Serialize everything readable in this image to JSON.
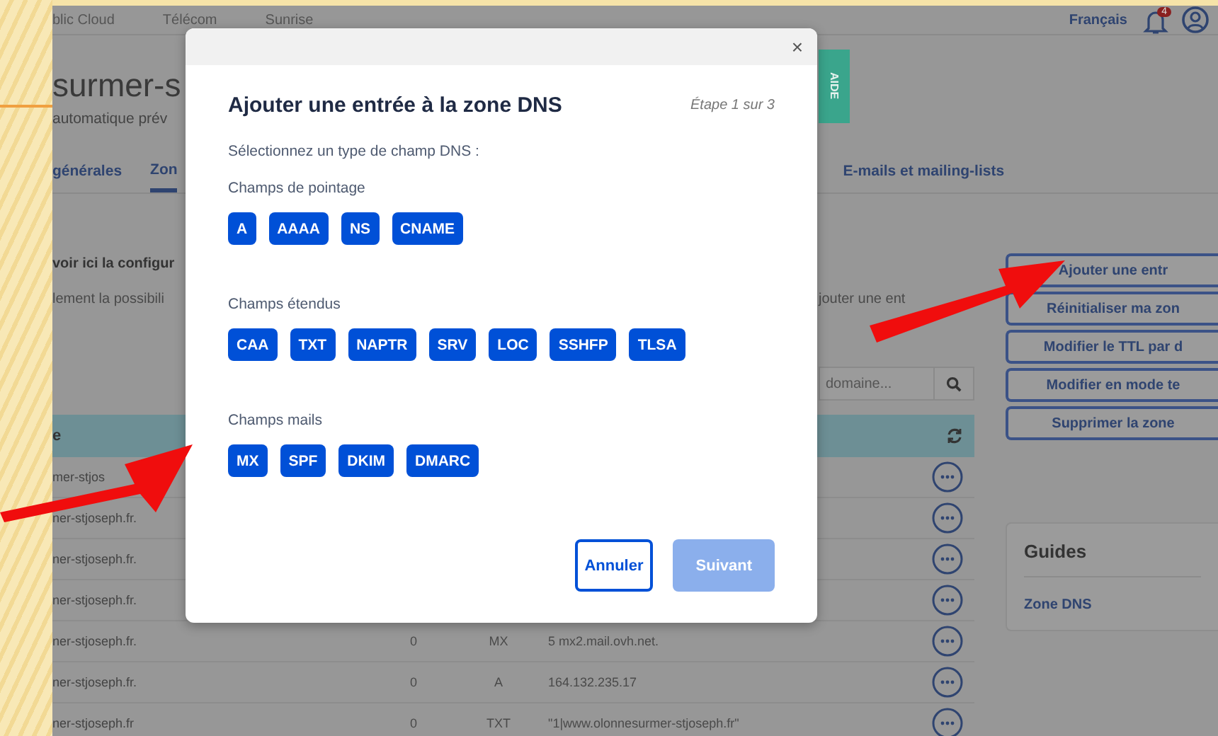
{
  "topnav": {
    "items": [
      "blic Cloud",
      "Télécom",
      "Sunrise"
    ],
    "language": "Français",
    "notification_count": "4"
  },
  "page": {
    "title": "surmer-s",
    "subtitle": "automatique prév",
    "tabs": [
      {
        "label": "générales",
        "selected": false
      },
      {
        "label": "Zon",
        "selected": true
      },
      {
        "label": "E-mails et mailing-lists",
        "selected": false
      }
    ],
    "help_tab": "AIDE",
    "intro_title": "voir ici la configur",
    "intro_text": "lement la possibili",
    "intro_text_right": "jouter une ent",
    "search": {
      "placeholder": "domaine..."
    },
    "table": {
      "column_1": "e",
      "rows": [
        {
          "name": "mer-stjos"
        },
        {
          "name": "ner-stjoseph.fr."
        },
        {
          "name": "ner-stjoseph.fr."
        },
        {
          "name": "ner-stjoseph.fr."
        },
        {
          "name": "ner-stjoseph.fr.",
          "ttl": "0",
          "type": "MX",
          "target": "5 mx2.mail.ovh.net."
        },
        {
          "name": "ner-stjoseph.fr.",
          "ttl": "0",
          "type": "A",
          "target": "164.132.235.17"
        },
        {
          "name": "ner-stjoseph.fr",
          "ttl": "0",
          "type": "TXT",
          "target": "\"1|www.olonnesurmer-stjoseph.fr\""
        }
      ]
    },
    "actions": [
      "Ajouter une entr",
      "Réinitialiser ma zon",
      "Modifier le TTL par d",
      "Modifier en mode te",
      "Supprimer la zone"
    ],
    "guides": {
      "title": "Guides",
      "links": [
        "Zone DNS"
      ]
    }
  },
  "modal": {
    "close": "×",
    "title": "Ajouter une entrée à la zone DNS",
    "step": "Étape 1 sur 3",
    "prompt": "Sélectionnez un type de champ DNS :",
    "groups": [
      {
        "label": "Champs de pointage",
        "types": [
          "A",
          "AAAA",
          "NS",
          "CNAME"
        ]
      },
      {
        "label": "Champs étendus",
        "types": [
          "CAA",
          "TXT",
          "NAPTR",
          "SRV",
          "LOC",
          "SSHFP",
          "TLSA"
        ]
      },
      {
        "label": "Champs mails",
        "types": [
          "MX",
          "SPF",
          "DKIM",
          "DMARC"
        ]
      }
    ],
    "cancel": {
      "label": "Annuler",
      "disabled": false
    },
    "next": {
      "label": "Suivant",
      "disabled": true
    }
  }
}
